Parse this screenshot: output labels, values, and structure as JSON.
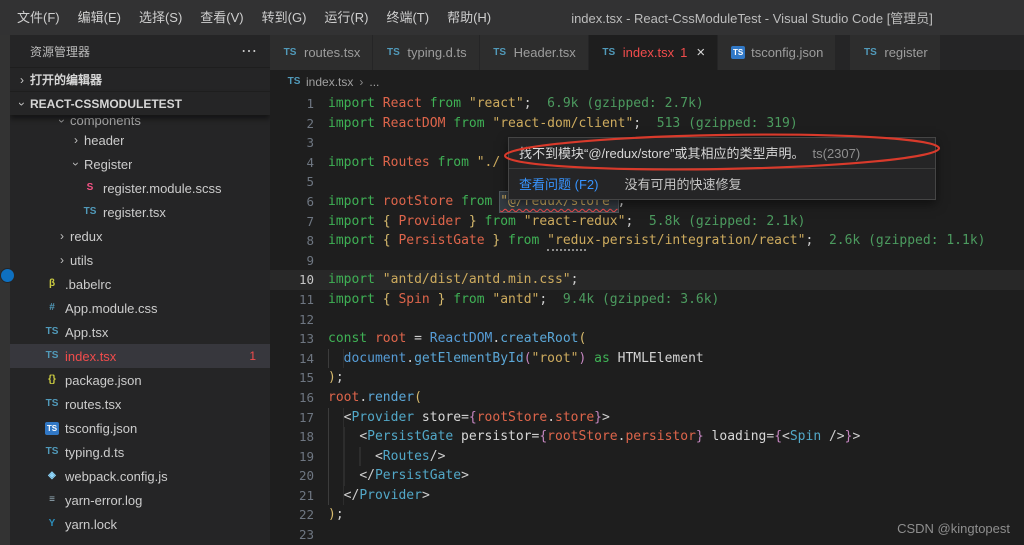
{
  "window": {
    "title": "index.tsx - React-CssModuleTest - Visual Studio Code [管理员]"
  },
  "menu": {
    "items": [
      "文件(F)",
      "编辑(E)",
      "选择(S)",
      "查看(V)",
      "转到(G)",
      "运行(R)",
      "终端(T)",
      "帮助(H)"
    ]
  },
  "sidebar": {
    "title": "资源管理器",
    "actions_icon": "⋯",
    "open_editors_label": "打开的编辑器",
    "project_label": "REACT-CSSMODULETEST",
    "tree": [
      {
        "label": "components",
        "type": "folder",
        "expanded": true,
        "indent": 2,
        "clipped": true
      },
      {
        "label": "header",
        "type": "folder",
        "expanded": false,
        "indent": 3
      },
      {
        "label": "Register",
        "type": "folder",
        "expanded": true,
        "indent": 3
      },
      {
        "label": "register.module.scss",
        "type": "file",
        "icon": "scss-icon",
        "indent": 4
      },
      {
        "label": "register.tsx",
        "type": "file",
        "icon": "ts-icon",
        "indent": 4
      },
      {
        "label": "redux",
        "type": "folder",
        "expanded": false,
        "indent": 2
      },
      {
        "label": "utils",
        "type": "folder",
        "expanded": false,
        "indent": 2
      },
      {
        "label": ".babelrc",
        "type": "file",
        "icon": "babel-icon",
        "indent": 1
      },
      {
        "label": "App.module.css",
        "type": "file",
        "icon": "css-icon",
        "indent": 1
      },
      {
        "label": "App.tsx",
        "type": "file",
        "icon": "ts-icon",
        "indent": 1
      },
      {
        "label": "index.tsx",
        "type": "file",
        "icon": "ts-icon",
        "indent": 1,
        "selected": true,
        "error": true,
        "badge": "1"
      },
      {
        "label": "package.json",
        "type": "file",
        "icon": "json-icon",
        "indent": 1
      },
      {
        "label": "routes.tsx",
        "type": "file",
        "icon": "ts-icon",
        "indent": 1
      },
      {
        "label": "tsconfig.json",
        "type": "file",
        "icon": "tsconfig-icon",
        "indent": 1
      },
      {
        "label": "typing.d.ts",
        "type": "file",
        "icon": "ts-icon",
        "indent": 1
      },
      {
        "label": "webpack.config.js",
        "type": "file",
        "icon": "webpack-icon",
        "indent": 1
      },
      {
        "label": "yarn-error.log",
        "type": "file",
        "icon": "log-icon",
        "indent": 1
      },
      {
        "label": "yarn.lock",
        "type": "file",
        "icon": "yarn-icon",
        "indent": 1
      }
    ]
  },
  "icons": {
    "ts-icon": {
      "glyph": "TS",
      "color": "#519aba"
    },
    "tsconfig-icon": {
      "glyph": "TS",
      "color": "#ffffff",
      "bg": "#3178c6"
    },
    "scss-icon": {
      "glyph": "S",
      "color": "#f55385"
    },
    "babel-icon": {
      "glyph": "β",
      "color": "#cbcb41"
    },
    "css-icon": {
      "glyph": "#",
      "color": "#519aba"
    },
    "json-icon": {
      "glyph": "{}",
      "color": "#cbcb41"
    },
    "webpack-icon": {
      "glyph": "◈",
      "color": "#8ed6fb"
    },
    "log-icon": {
      "glyph": "≡",
      "color": "#9cb4c0"
    },
    "yarn-icon": {
      "glyph": "Y",
      "color": "#2c8ebb"
    }
  },
  "tabs": [
    {
      "label": "routes.tsx",
      "icon": "ts-icon"
    },
    {
      "label": "typing.d.ts",
      "icon": "ts-icon"
    },
    {
      "label": "Header.tsx",
      "icon": "ts-icon"
    },
    {
      "label": "index.tsx",
      "icon": "ts-icon",
      "active": true,
      "error_badge": "1",
      "close_icon": "×"
    },
    {
      "label": "tsconfig.json",
      "icon": "tsconfig-icon"
    },
    {
      "label": "register",
      "icon": "ts-icon",
      "gapped": true
    }
  ],
  "breadcrumb": {
    "icon": "ts-icon",
    "file": "index.tsx",
    "separator": "›",
    "tail": "..."
  },
  "tooltip": {
    "message": "找不到模块“@/redux/store”或其相应的类型声明。",
    "code": "ts(2307)",
    "action": "查看问题 (F2)",
    "no_quickfix": "没有可用的快速修复"
  },
  "watermark": "CSDN @kingtopest",
  "colors": {
    "error": "#f14c4c",
    "link": "#3794ff",
    "annotation": "#d93a2b",
    "badge": "#0e70c0"
  },
  "editor": {
    "lines": [
      {
        "n": 1,
        "indent": 0,
        "tokens": [
          [
            "kw",
            "import"
          ],
          [
            "id",
            " React"
          ],
          [
            "kw",
            " from"
          ],
          [
            "str",
            " \"react\""
          ],
          [
            "pun",
            ";"
          ],
          [
            "cost",
            "  6.9k (gzipped: 2.7k)"
          ]
        ]
      },
      {
        "n": 2,
        "indent": 0,
        "tokens": [
          [
            "kw",
            "import"
          ],
          [
            "id",
            " ReactDOM"
          ],
          [
            "kw",
            " from"
          ],
          [
            "str",
            " \"react-dom/client\""
          ],
          [
            "pun",
            ";"
          ],
          [
            "cost",
            "  513 (gzipped: 319)"
          ]
        ]
      },
      {
        "n": 3,
        "indent": 0,
        "tokens": []
      },
      {
        "n": 4,
        "indent": 0,
        "tokens": [
          [
            "kw",
            "import"
          ],
          [
            "id",
            " Routes"
          ],
          [
            "kw",
            " from"
          ],
          [
            "str",
            " \"./"
          ]
        ]
      },
      {
        "n": 5,
        "indent": 0,
        "tokens": []
      },
      {
        "n": 6,
        "indent": 0,
        "tokens": [
          [
            "kw",
            "import"
          ],
          [
            "id",
            " rootStore"
          ],
          [
            "kw",
            " from"
          ],
          [
            "plain",
            " "
          ],
          [
            "strhl",
            "\"@/redux/store\""
          ],
          [
            "pun",
            ";"
          ]
        ]
      },
      {
        "n": 7,
        "indent": 0,
        "tokens": [
          [
            "kw",
            "import"
          ],
          [
            "br1",
            " {"
          ],
          [
            "id",
            " Provider"
          ],
          [
            "br1",
            " }"
          ],
          [
            "kw",
            " from"
          ],
          [
            "str",
            " \"react-redux\""
          ],
          [
            "pun",
            ";"
          ],
          [
            "cost",
            "  5.8k (gzipped: 2.1k)"
          ]
        ]
      },
      {
        "n": 8,
        "indent": 0,
        "tokens": [
          [
            "kw",
            "import"
          ],
          [
            "br1",
            " {"
          ],
          [
            "id",
            " PersistGate"
          ],
          [
            "br1",
            " }"
          ],
          [
            "kw",
            " from"
          ],
          [
            "plain",
            " "
          ],
          [
            "strdots",
            "\"redu"
          ],
          [
            "str",
            "x-persist/integration/react\""
          ],
          [
            "pun",
            ";"
          ],
          [
            "cost",
            "  2.6k (gzipped: 1.1k)"
          ]
        ]
      },
      {
        "n": 9,
        "indent": 0,
        "tokens": []
      },
      {
        "n": 10,
        "indent": 0,
        "current": true,
        "tokens": [
          [
            "kw",
            "import"
          ],
          [
            "str",
            " \"antd/dist/antd.min.css\""
          ],
          [
            "pun",
            ";"
          ]
        ]
      },
      {
        "n": 11,
        "indent": 0,
        "tokens": [
          [
            "kw",
            "import"
          ],
          [
            "br1",
            " {"
          ],
          [
            "id",
            " Spin"
          ],
          [
            "br1",
            " }"
          ],
          [
            "kw",
            " from"
          ],
          [
            "str",
            " \"antd\""
          ],
          [
            "pun",
            ";"
          ],
          [
            "cost",
            "  9.4k (gzipped: 3.6k)"
          ]
        ]
      },
      {
        "n": 12,
        "indent": 0,
        "tokens": []
      },
      {
        "n": 13,
        "indent": 0,
        "tokens": [
          [
            "kw",
            "const"
          ],
          [
            "id",
            " root"
          ],
          [
            "pun",
            " ="
          ],
          [
            "cls",
            " ReactDOM"
          ],
          [
            "pun",
            "."
          ],
          [
            "fn",
            "createRoot"
          ],
          [
            "br1",
            "("
          ]
        ]
      },
      {
        "n": 14,
        "indent": 1,
        "tokens": [
          [
            "cls",
            "document"
          ],
          [
            "pun",
            "."
          ],
          [
            "fn",
            "getElementById"
          ],
          [
            "br2",
            "("
          ],
          [
            "str",
            "\"root\""
          ],
          [
            "br2",
            ")"
          ],
          [
            "kw",
            " as"
          ],
          [
            "plain",
            " HTMLElement"
          ]
        ]
      },
      {
        "n": 15,
        "indent": 0,
        "tokens": [
          [
            "br1",
            ")"
          ],
          [
            "pun",
            ";"
          ]
        ]
      },
      {
        "n": 16,
        "indent": 0,
        "tokens": [
          [
            "id",
            "root"
          ],
          [
            "pun",
            "."
          ],
          [
            "fn",
            "render"
          ],
          [
            "br1",
            "("
          ]
        ]
      },
      {
        "n": 17,
        "indent": 1,
        "tokens": [
          [
            "pun",
            "<"
          ],
          [
            "cmp",
            "Provider"
          ],
          [
            "attr",
            " store"
          ],
          [
            "pun",
            "="
          ],
          [
            "br2",
            "{"
          ],
          [
            "id",
            "rootStore"
          ],
          [
            "pun",
            "."
          ],
          [
            "id",
            "store"
          ],
          [
            "br2",
            "}"
          ],
          [
            "pun",
            ">"
          ]
        ]
      },
      {
        "n": 18,
        "indent": 2,
        "tokens": [
          [
            "pun",
            "<"
          ],
          [
            "cmp",
            "PersistGate"
          ],
          [
            "attr",
            " persistor"
          ],
          [
            "pun",
            "="
          ],
          [
            "br2",
            "{"
          ],
          [
            "id",
            "rootStore"
          ],
          [
            "pun",
            "."
          ],
          [
            "id",
            "persistor"
          ],
          [
            "br2",
            "}"
          ],
          [
            "attr",
            " loading"
          ],
          [
            "pun",
            "="
          ],
          [
            "br2",
            "{"
          ],
          [
            "pun",
            "<"
          ],
          [
            "cmp",
            "Spin"
          ],
          [
            "pun",
            " />"
          ],
          [
            "br2",
            "}"
          ],
          [
            "pun",
            ">"
          ]
        ]
      },
      {
        "n": 19,
        "indent": 3,
        "tokens": [
          [
            "pun",
            "<"
          ],
          [
            "cmp",
            "Routes"
          ],
          [
            "pun",
            "/>"
          ]
        ]
      },
      {
        "n": 20,
        "indent": 2,
        "tokens": [
          [
            "pun",
            "</"
          ],
          [
            "cmp",
            "PersistGate"
          ],
          [
            "pun",
            ">"
          ]
        ]
      },
      {
        "n": 21,
        "indent": 1,
        "tokens": [
          [
            "pun",
            "</"
          ],
          [
            "cmp",
            "Provider"
          ],
          [
            "pun",
            ">"
          ]
        ]
      },
      {
        "n": 22,
        "indent": 0,
        "tokens": [
          [
            "br1",
            ")"
          ],
          [
            "pun",
            ";"
          ]
        ]
      },
      {
        "n": 23,
        "indent": 0,
        "tokens": []
      }
    ]
  }
}
